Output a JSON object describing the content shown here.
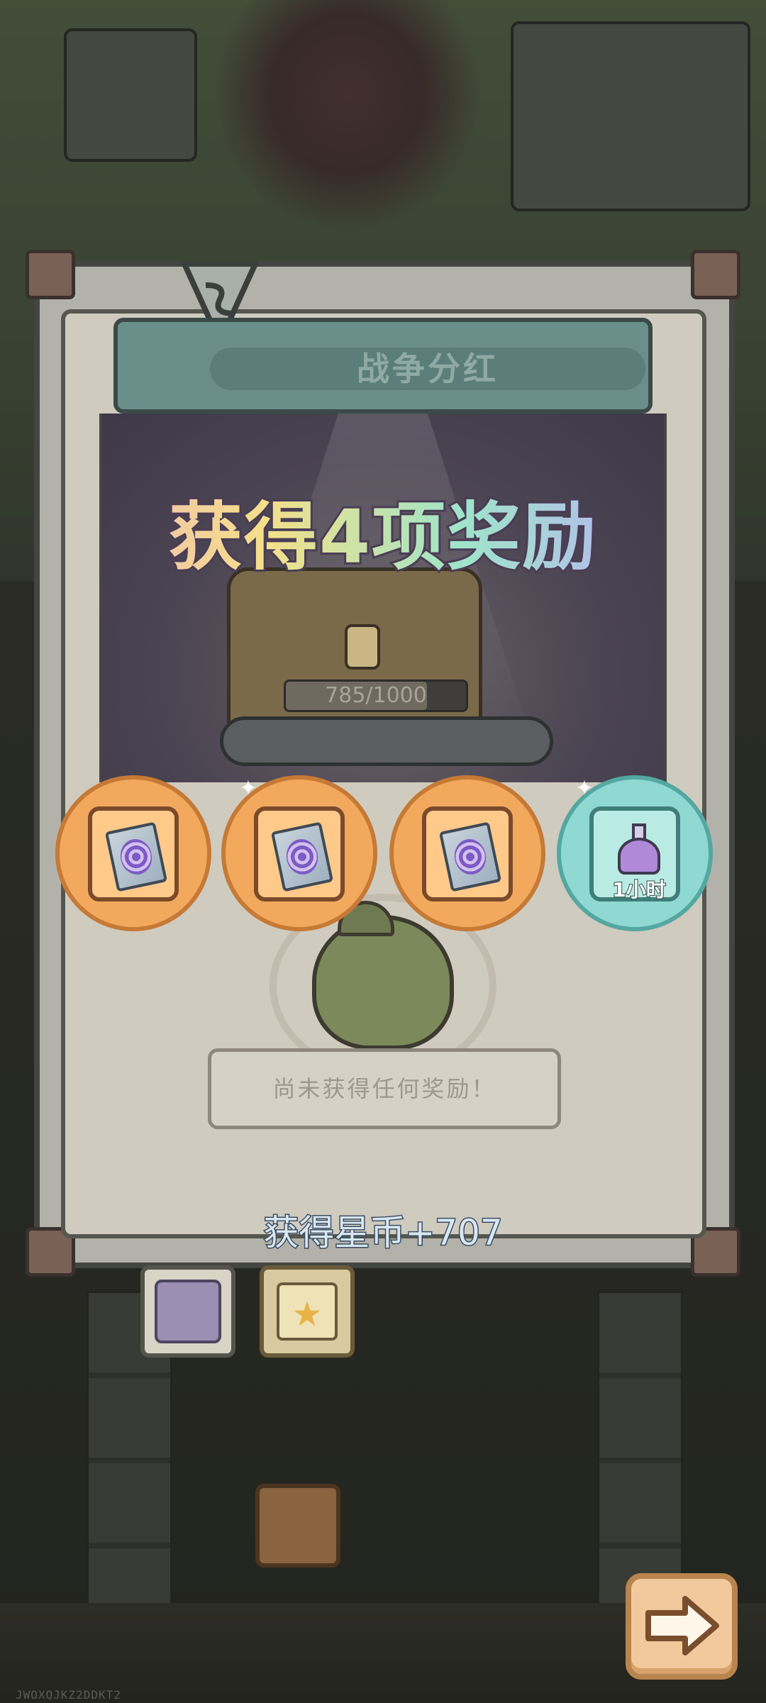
{
  "panel": {
    "title": "战争分红",
    "headline": "获得4项奖励"
  },
  "chest_progress": {
    "text": "785/1000",
    "current": 785,
    "max": 1000
  },
  "rewards": [
    {
      "type": "scroll",
      "icon": "purple-swirl-scroll-icon",
      "background": "#f2a95e",
      "duration": ""
    },
    {
      "type": "scroll",
      "icon": "purple-swirl-scroll-icon",
      "background": "#f2a95e",
      "duration": ""
    },
    {
      "type": "scroll",
      "icon": "purple-swirl-scroll-icon",
      "background": "#f2a95e",
      "duration": ""
    },
    {
      "type": "potion",
      "icon": "purple-potion-flask-icon",
      "background": "#8fd9d2",
      "duration": "1小时"
    }
  ],
  "empty_message": "尚未获得任何奖励！",
  "star_coins": "获得星币+707",
  "tabs": [
    {
      "name": "chest-tab",
      "icon": "treasure-chest-icon"
    },
    {
      "name": "calendar-tab",
      "icon": "calendar-star-icon"
    }
  ],
  "next_button": {
    "icon": "right-arrow-icon"
  },
  "watermark": "JWOXQJKZ2DDKT2",
  "colors": {
    "headline_gradient": [
      "#f1a6c8",
      "#f4e08a",
      "#9fe5c9",
      "#b8b5f2"
    ],
    "title_bar": "#6a8f8b",
    "reward_orange": "#f2a95e",
    "reward_teal": "#8fd9d2"
  }
}
